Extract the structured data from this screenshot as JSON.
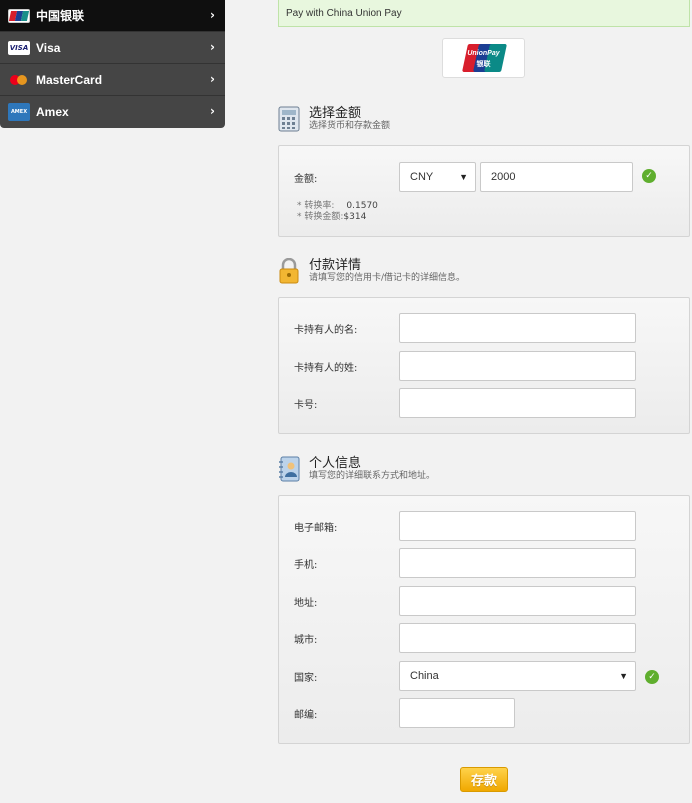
{
  "sidebar": {
    "items": [
      {
        "label": "中国银联",
        "active": true,
        "logo": "unionpay-logo"
      },
      {
        "label": "Visa",
        "active": false,
        "logo": "visa-logo"
      },
      {
        "label": "MasterCard",
        "active": false,
        "logo": "mastercard-logo"
      },
      {
        "label": "Amex",
        "active": false,
        "logo": "amex-logo"
      }
    ],
    "chevron": "›"
  },
  "banner": {
    "text": "Pay with China Union Pay"
  },
  "unionpay_logo": {
    "line1": "UnionPay",
    "line2": "银联"
  },
  "amount_section": {
    "title": "选择金额",
    "subtitle": "选择货币和存款金额",
    "amount_label": "金额:",
    "currency": "CNY",
    "amount_value": "2000",
    "rate_label": "* 转换率:",
    "rate_value": "0.1570",
    "converted_label": "* 转换金额:",
    "converted_value": "$314"
  },
  "payment_section": {
    "title": "付款详情",
    "subtitle": "请填写您的信用卡/借记卡的详细信息。",
    "first_name_label": "卡持有人的名:",
    "last_name_label": "卡持有人的姓:",
    "card_number_label": "卡号:"
  },
  "personal_section": {
    "title": "个人信息",
    "subtitle": "填写您的详细联系方式和地址。",
    "email_label": "电子邮箱:",
    "phone_label": "手机:",
    "address_label": "地址:",
    "city_label": "城市:",
    "country_label": "国家:",
    "country_value": "China",
    "zip_label": "邮编:"
  },
  "submit": {
    "label": "存款"
  },
  "colors": {
    "accent": "#f0a800",
    "success": "#5fae2e",
    "banner_bg": "#e8f7de"
  }
}
